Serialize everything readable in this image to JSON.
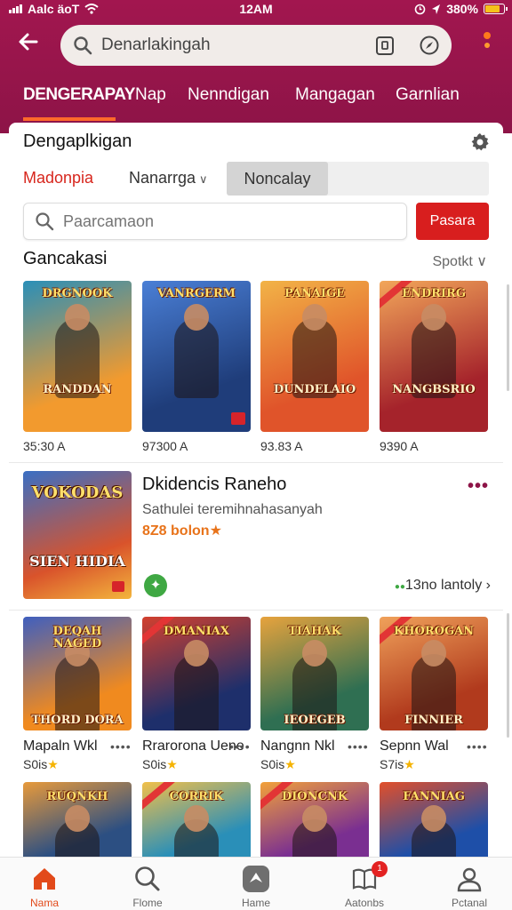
{
  "status_bar": {
    "carrier": "Aalc äoT",
    "time": "12AM",
    "battery": "380%",
    "battery_level": 0.8
  },
  "header": {
    "search_value": "Denarlakingah",
    "back_icon": "arrow-left-icon",
    "tabs": [
      {
        "label": "DENGERAPAY",
        "active": true
      },
      {
        "label": "Nap",
        "active": false
      },
      {
        "label": "Nenndigan",
        "active": false
      },
      {
        "label": "Mangagan",
        "active": false
      },
      {
        "label": "Garnlian",
        "active": false
      }
    ]
  },
  "card": {
    "title": "Dengaplkigan",
    "filters": {
      "active": "Madonpia",
      "dropdown": "Nanarrga",
      "segment": "Noncalay"
    },
    "search": {
      "placeholder": "Paarcamaon",
      "button": "Pasara"
    },
    "section_title": "Gancakasi",
    "section_sort": "Spotkt"
  },
  "top_games": [
    {
      "logo": "DRGNOOK",
      "subtitle": "RANDDAN",
      "price": "35:30 A",
      "colors": [
        "#f29a2e",
        "#2a8fb8"
      ]
    },
    {
      "logo": "VANRGERM",
      "subtitle": "",
      "price": "97300 A",
      "colors": [
        "#1f3d7a",
        "#4a7fd6"
      ]
    },
    {
      "logo": "PANAIGE",
      "subtitle": "DUNDELAIO",
      "price": "93.83 A",
      "colors": [
        "#e0542a",
        "#f2b347"
      ]
    },
    {
      "logo": "ENDRIRG",
      "subtitle": "NANGBSRIO",
      "price": "9390 A",
      "colors": [
        "#a5232b",
        "#f2a65a"
      ]
    }
  ],
  "featured": {
    "title": "Dkidencis Raneho",
    "subtitle": "Sathulei teremihnahasanyah",
    "price": "8Z8 bolon",
    "art_logo": "VOKODAS",
    "art_sub": "SIEN HIDIA",
    "link": "13no lantoly"
  },
  "bottom_games": [
    {
      "logo": "DEQAH NAGED",
      "footer": "THORD DORA",
      "name": "Mapaln Wkl",
      "rating": "S0is",
      "colors": [
        "#f08a1f",
        "#3f5fbf"
      ]
    },
    {
      "logo": "DMANIAX",
      "footer": "",
      "name": "Rrarorona Uene",
      "rating": "S0is",
      "colors": [
        "#1e2f6b",
        "#d2402e"
      ]
    },
    {
      "logo": "TIAHAK",
      "footer": "IEOEGEB",
      "name": "Nangnn Nkl",
      "rating": "S0is",
      "colors": [
        "#2f6f52",
        "#e7a33d"
      ]
    },
    {
      "logo": "KHOROGAN",
      "footer": "FINNIER",
      "name": "Sepnn Wal",
      "rating": "S7is",
      "colors": [
        "#b13a1d",
        "#f0a15a"
      ]
    }
  ],
  "partial_games": [
    {
      "logo": "RUQNKH",
      "colors": [
        "#2c4f82",
        "#e89a3b"
      ]
    },
    {
      "logo": "CORRIK",
      "colors": [
        "#2a8fb8",
        "#f1c04a"
      ]
    },
    {
      "logo": "DIONCNK",
      "colors": [
        "#7a2f91",
        "#f2a13a"
      ]
    },
    {
      "logo": "FANNIAG",
      "colors": [
        "#1e4fa8",
        "#e24f2a"
      ]
    }
  ],
  "bottom_nav": [
    {
      "label": "Nama",
      "icon": "home-icon",
      "active": true
    },
    {
      "label": "Flome",
      "icon": "search-icon",
      "active": false
    },
    {
      "label": "Hame",
      "icon": "game-icon",
      "active": false
    },
    {
      "label": "Aatonbs",
      "icon": "book-icon",
      "active": false,
      "badge": "1"
    },
    {
      "label": "Pctanal",
      "icon": "person-icon",
      "active": false
    }
  ]
}
